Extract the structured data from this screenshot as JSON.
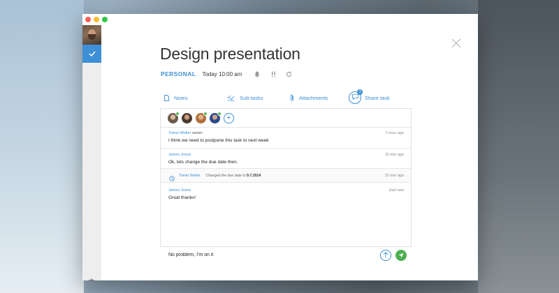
{
  "window": {
    "title": "Design presentation"
  },
  "task": {
    "list_name": "PERSONAL",
    "due": "Today 10:00 am"
  },
  "tabs": [
    {
      "label": "Notes"
    },
    {
      "label": "Sub-tasks"
    },
    {
      "label": "Attachments"
    },
    {
      "label": "Share task",
      "badge": "3"
    }
  ],
  "comments": [
    {
      "author": "Tomer Weller",
      "role": "owner",
      "time": "1 hour ago",
      "text": "I think we need to postpone this task to next week"
    },
    {
      "author": "James Jones",
      "role": "",
      "time": "15 min ago",
      "text": "Ok, lets change the due date then."
    },
    {
      "author": "James Jones",
      "role": "",
      "time": "Just now",
      "text": "Great thanks!"
    }
  ],
  "activity": {
    "author": "Tomer Weller",
    "text": "Changed the due date to",
    "date": "9.7.2014",
    "time": "15 min ago"
  },
  "composer": {
    "value": "No problem, I'm on it"
  },
  "colors": {
    "accent": "#3d8fd6",
    "send": "#4caf50",
    "online": "#5cb85c"
  },
  "icons": {
    "sidebar_check": "check-icon",
    "settings": "gear-icon",
    "close": "close-icon",
    "reminder": "bell-icon",
    "priority": "priority-icon",
    "repeat": "repeat-icon",
    "notes": "document-icon",
    "subtasks": "checklist-icon",
    "attachments": "paperclip-icon",
    "share": "chat-icon",
    "upload": "arrow-up-icon",
    "send": "send-icon"
  }
}
